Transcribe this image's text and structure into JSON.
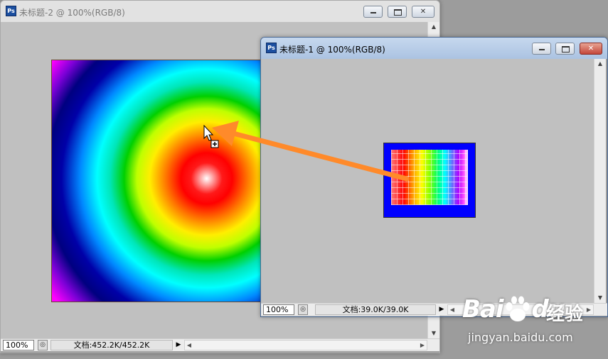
{
  "doc2": {
    "title": "未标题-2 @ 100%(RGB/8)",
    "icon_label": "Ps",
    "zoom": "100%",
    "doc_info": "文档:452.2K/452.2K"
  },
  "doc1": {
    "title": "未标题-1 @ 100%(RGB/8)",
    "icon_label": "Ps",
    "zoom": "100%",
    "doc_info": "文档:39.0K/39.0K"
  },
  "controls": {
    "minimize": "minimize-icon",
    "maximize": "maximize-icon",
    "close": "✕"
  },
  "icons": {
    "scroll_up": "▲",
    "scroll_down": "▼",
    "scroll_left": "◀",
    "scroll_right": "▶",
    "status_menu": "▶",
    "status_btn": "◎"
  },
  "watermark": {
    "logo_latin": "Bai",
    "logo_tail": "du",
    "cn": "经验",
    "url": "jingyan.baidu.com"
  },
  "colors": {
    "arrow": "#ff8a2a",
    "canvas_gray": "#c0c0c0",
    "workspace": "#9c9c9c",
    "active_title": "#abc3e2",
    "close_red": "#c4463a"
  }
}
